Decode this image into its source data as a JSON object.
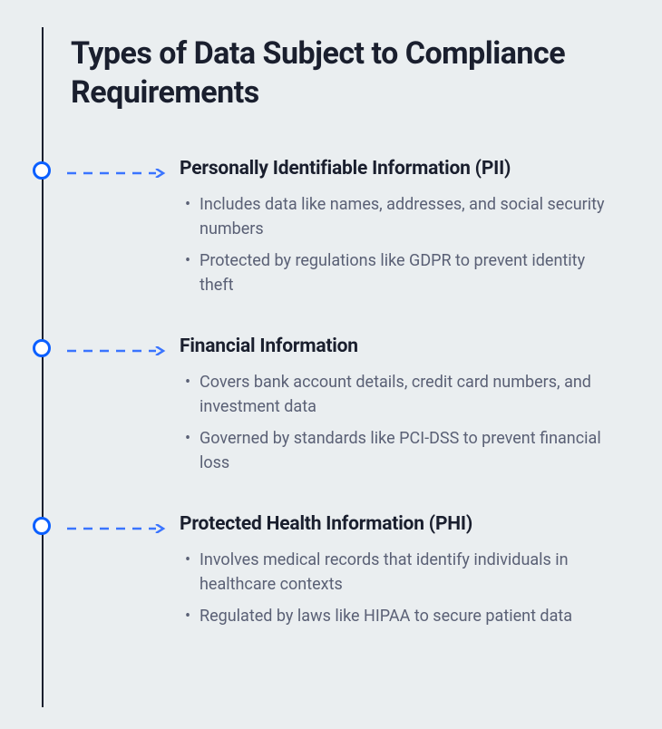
{
  "title": "Types of Data Subject to Compliance Requirements",
  "items": [
    {
      "heading": "Personally Identifiable Information (PII)",
      "bullets": [
        "Includes data like names, addresses, and social security numbers",
        "Protected by regulations like GDPR to prevent identity theft"
      ]
    },
    {
      "heading": "Financial Information",
      "bullets": [
        "Covers bank account details, credit card numbers, and investment data",
        "Governed by standards like PCI-DSS to prevent financial loss"
      ]
    },
    {
      "heading": "Protected Health Information (PHI)",
      "bullets": [
        " Involves medical records that identify individuals in healthcare contexts",
        "Regulated by laws like HIPAA to secure patient data"
      ]
    }
  ],
  "colors": {
    "accent": "#0b5fff",
    "arrow": "#3a74ff",
    "text_primary": "#1a1f2e",
    "text_secondary": "#5a6075",
    "background": "#eaeef0"
  }
}
